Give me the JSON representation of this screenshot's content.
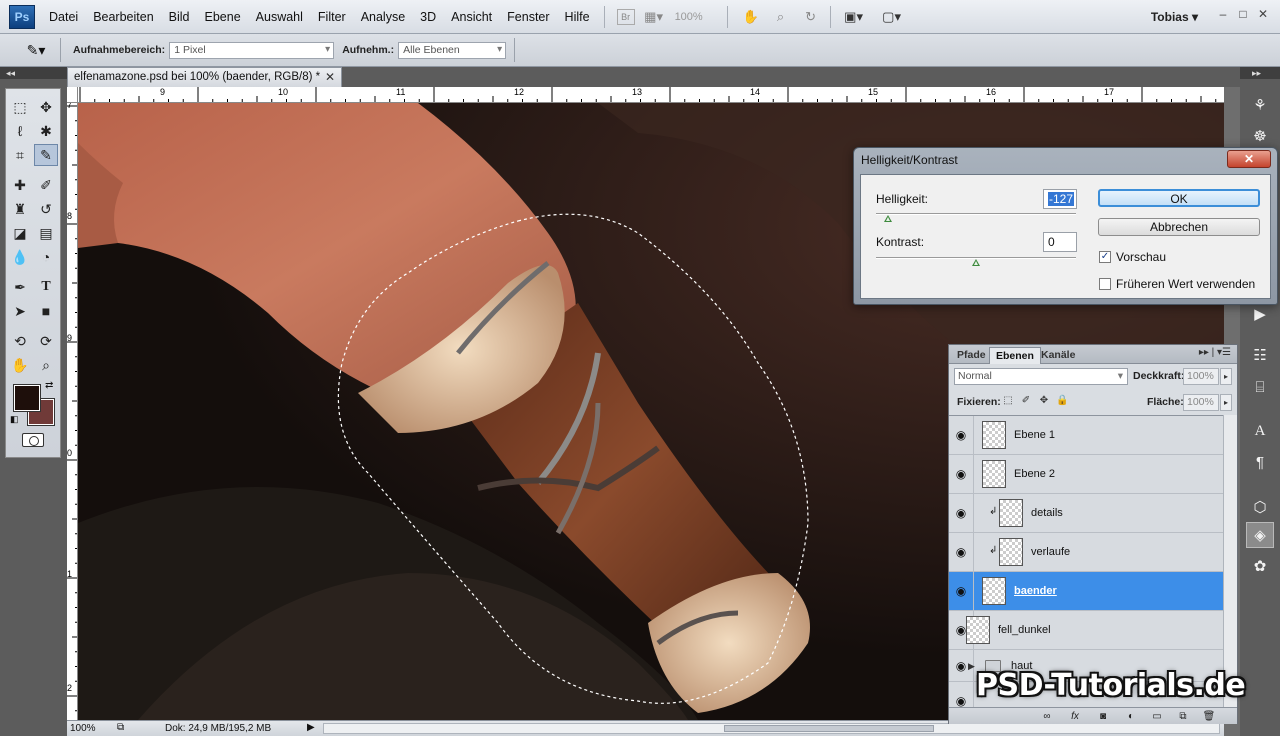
{
  "menubar": {
    "items": [
      "Datei",
      "Bearbeiten",
      "Bild",
      "Ebene",
      "Auswahl",
      "Filter",
      "Analyse",
      "3D",
      "Ansicht",
      "Fenster",
      "Hilfe"
    ],
    "zoom": "100%",
    "user": "Tobias"
  },
  "options": {
    "sample_area_label": "Aufnahmebereich:",
    "sample_area_value": "1 Pixel",
    "sample_label": "Aufnehm.:",
    "sample_value": "Alle Ebenen"
  },
  "document": {
    "tab_title": "elfenamazone.psd bei 100% (baender, RGB/8) *"
  },
  "rulers": {
    "top": [
      "9",
      "10",
      "11",
      "12",
      "13",
      "14",
      "15",
      "16",
      "17"
    ],
    "left": [
      "7",
      "8",
      "9",
      "0",
      "1",
      "2"
    ]
  },
  "status": {
    "zoom": "100%",
    "doc_size": "Dok: 24,9 MB/195,2 MB"
  },
  "dialog": {
    "title": "Helligkeit/Kontrast",
    "brightness_label": "Helligkeit:",
    "brightness_value": "-127",
    "brightness_level": 0.06,
    "contrast_label": "Kontrast:",
    "contrast_value": "0",
    "contrast_level": 0.5,
    "ok_label": "OK",
    "cancel_label": "Abbrechen",
    "preview_label": "Vorschau",
    "preview_checked": true,
    "legacy_label": "Früheren Wert verwenden",
    "legacy_checked": false
  },
  "layers_panel": {
    "tabs": [
      "Pfade",
      "Ebenen",
      "Kanäle"
    ],
    "active_tab": "Ebenen",
    "blend_mode": "Normal",
    "opacity_label": "Deckkraft:",
    "opacity_value": "100%",
    "lock_label": "Fixieren:",
    "fill_label": "Fläche:",
    "fill_value": "100%",
    "layers": [
      {
        "name": "Ebene 1",
        "visible": true,
        "clipped": false,
        "selected": false
      },
      {
        "name": "Ebene 2",
        "visible": true,
        "clipped": false,
        "selected": false
      },
      {
        "name": "details",
        "visible": true,
        "clipped": true,
        "selected": false
      },
      {
        "name": "verlaufe",
        "visible": true,
        "clipped": true,
        "selected": false
      },
      {
        "name": "baender",
        "visible": true,
        "clipped": false,
        "selected": true
      },
      {
        "name": "fell_dunkel",
        "visible": true,
        "clipped": false,
        "selected": false
      },
      {
        "name": "haut",
        "visible": true,
        "group": true,
        "selected": false
      }
    ]
  },
  "watermark": "PSD-Tutorials.de",
  "colors": {
    "foreground": "#1e0f0b",
    "background": "#703a38",
    "selection": "#3d8ee8"
  }
}
